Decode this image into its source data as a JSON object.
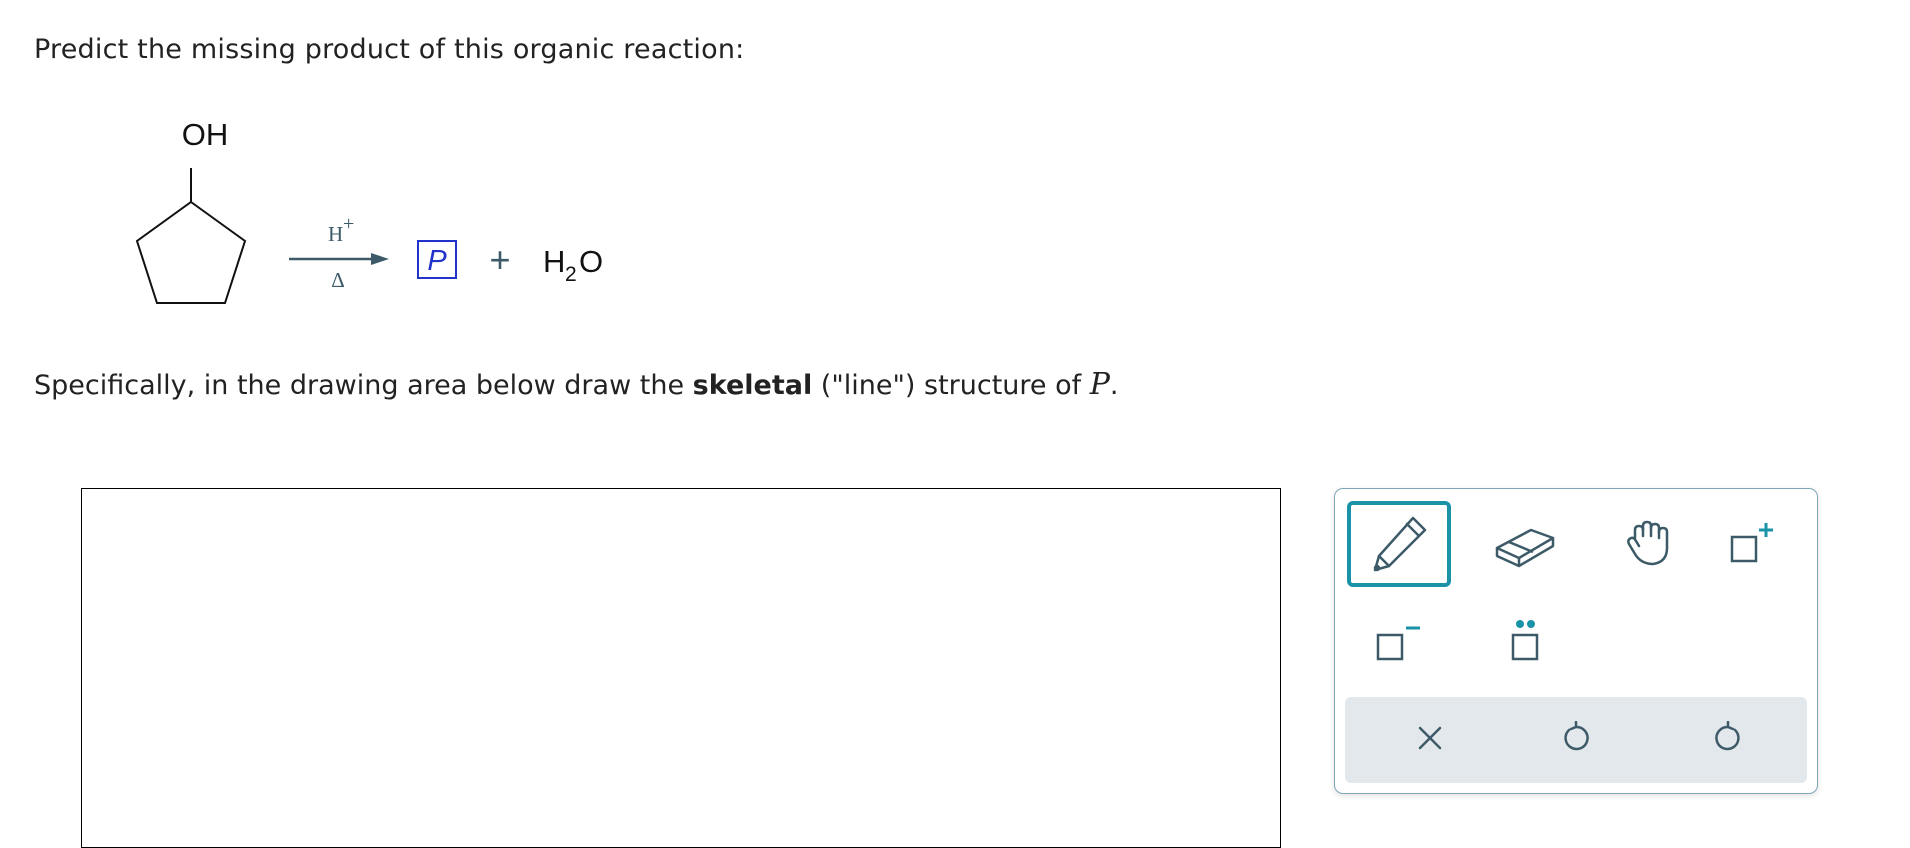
{
  "question": {
    "prompt": "Predict the missing product of this organic reaction:",
    "instruction_pre": "Specifically, in the drawing area below draw the ",
    "instruction_bold": "skeletal",
    "instruction_post": " (\"line\") structure of ",
    "instruction_var": "P",
    "instruction_end": "."
  },
  "reaction": {
    "reactant_group": "OH",
    "reagent_top": "H",
    "reagent_top_charge": "+",
    "reagent_bottom": "Δ",
    "product_label": "P",
    "plus": "+",
    "byproduct_h": "H",
    "byproduct_sub": "2",
    "byproduct_o": "O"
  },
  "toolbar": {
    "tools": [
      {
        "name": "pencil-tool",
        "icon": "pencil-icon",
        "selected": true
      },
      {
        "name": "eraser-tool",
        "icon": "eraser-icon",
        "selected": false
      },
      {
        "name": "hand-tool",
        "icon": "hand-icon",
        "selected": false
      },
      {
        "name": "positive-charge-tool",
        "icon": "add-charge-icon",
        "selected": false
      },
      {
        "name": "negative-charge-tool",
        "icon": "remove-charge-icon",
        "selected": false
      },
      {
        "name": "lone-pair-tool",
        "icon": "lone-pair-icon",
        "selected": false
      }
    ],
    "actions": [
      "clear-icon",
      "undo-icon",
      "redo-icon"
    ]
  },
  "colors": {
    "accent": "#1a92a8",
    "icon": "#3d5a68",
    "product_box": "#2233cc",
    "panel_border": "#7fa7b8",
    "action_bar": "#e2e8eb"
  }
}
